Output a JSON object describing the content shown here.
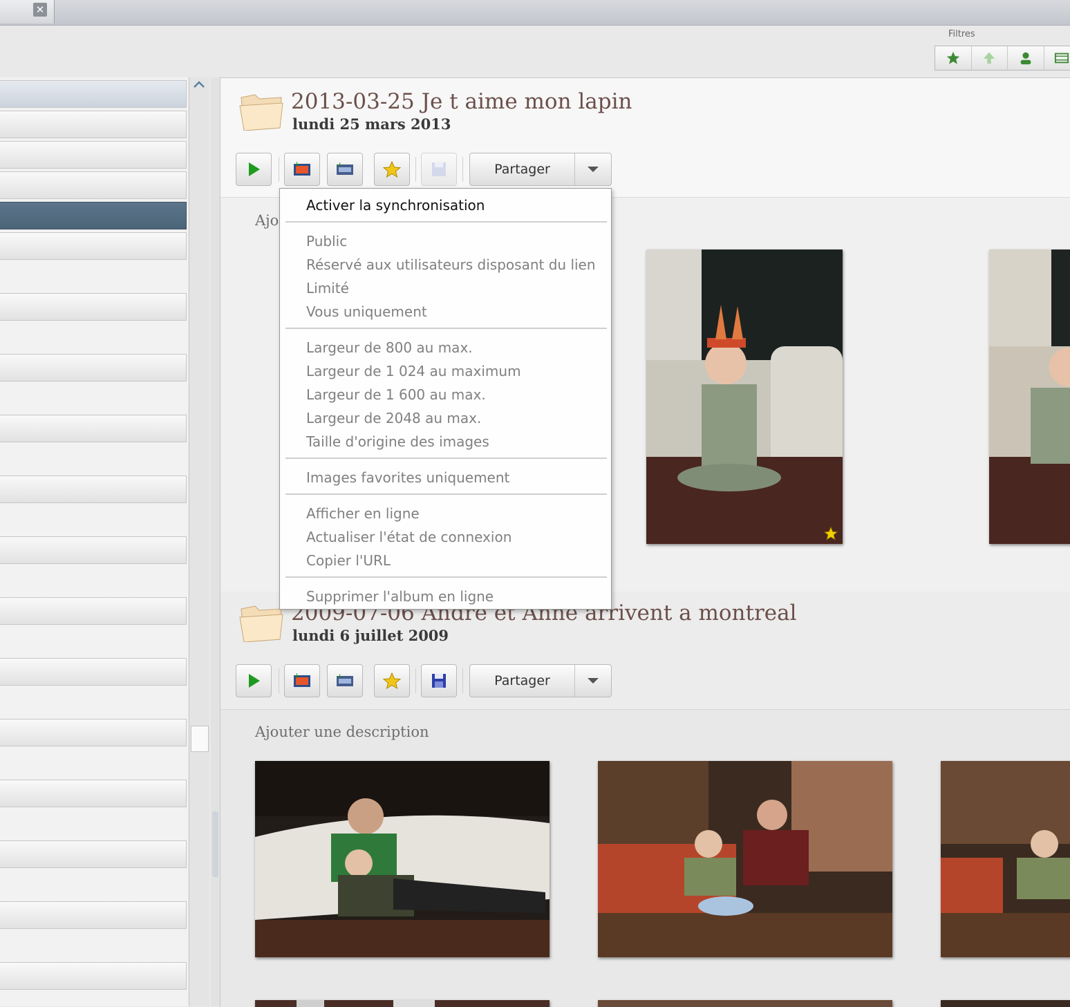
{
  "window": {
    "close_glyph": "✕"
  },
  "filters": {
    "label": "Filtres",
    "buttons": [
      "star-filter-icon",
      "upload-filter-icon",
      "person-filter-icon",
      "movie-filter-icon"
    ]
  },
  "albums": [
    {
      "title": "2013-03-25 Je t aime mon lapin",
      "date": "lundi 25 mars 2013",
      "description_visible": "Ajo",
      "share_label": "Partager"
    },
    {
      "title": "2009-07-06 Andre et Anne arrivent a montreal",
      "date": "lundi 6 juillet 2009",
      "description": "Ajouter une description",
      "share_label": "Partager"
    }
  ],
  "share_menu": {
    "items": [
      "Activer la synchronisation",
      "Public",
      "Réservé aux utilisateurs disposant du lien",
      "Limité",
      "Vous uniquement",
      "Largeur de 800 au max.",
      "Largeur de 1 024 au maximum",
      "Largeur de 1 600 au max.",
      "Largeur de 2048 au max.",
      "Taille d'origine des images",
      "Images favorites uniquement",
      "Afficher en ligne",
      "Actualiser l'état de connexion",
      "Copier l'URL",
      "Supprimer l'album en ligne"
    ]
  },
  "colors": {
    "accent": "#2a9a1f",
    "title": "#6b4f4a",
    "selected_row": "#526b80"
  }
}
